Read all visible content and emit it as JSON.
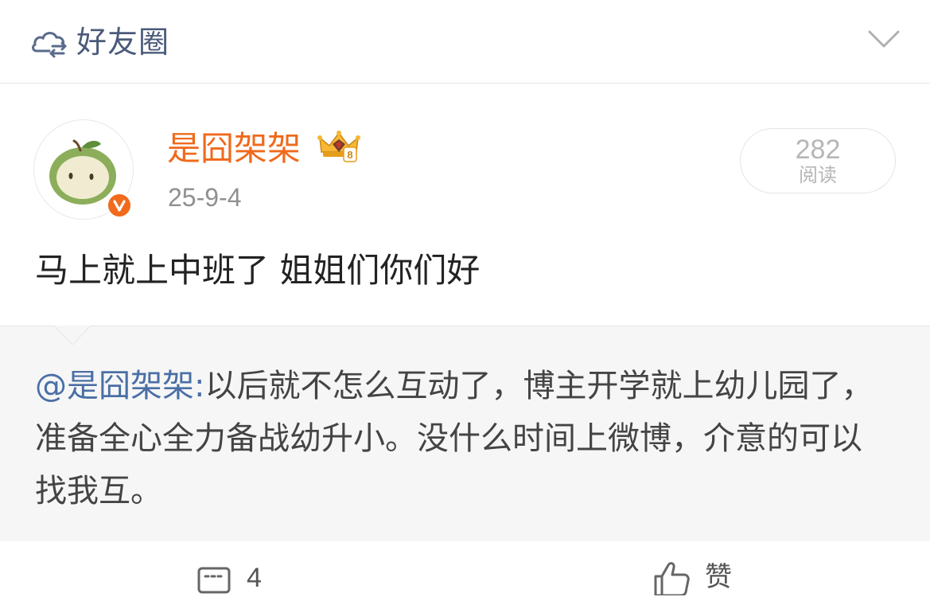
{
  "header": {
    "title": "好友圈",
    "icon": "friends-circle-icon",
    "collapse_icon": "chevron-down-icon"
  },
  "post": {
    "author": "是囧架架",
    "date": "25-9-4",
    "reads_count": "282",
    "reads_label": "阅读",
    "text": "马上就上中班了 姐姐们你们好",
    "badge_icon": "crown-icon",
    "verified_icon": "verified-v-icon"
  },
  "repost": {
    "author": "@是囧架架",
    "separator": ":",
    "text": "以后就不怎么互动了，博主开学就上幼儿园了，准备全心全力备战幼升小。没什么时间上微博，介意的可以找我互。"
  },
  "actions": {
    "comment_count": "4",
    "like_label": "赞"
  },
  "colors": {
    "author": "#ef6a1c",
    "link": "#4a6fa5",
    "repost_bg": "#f6f6f6",
    "verified": "#f26a1b"
  }
}
